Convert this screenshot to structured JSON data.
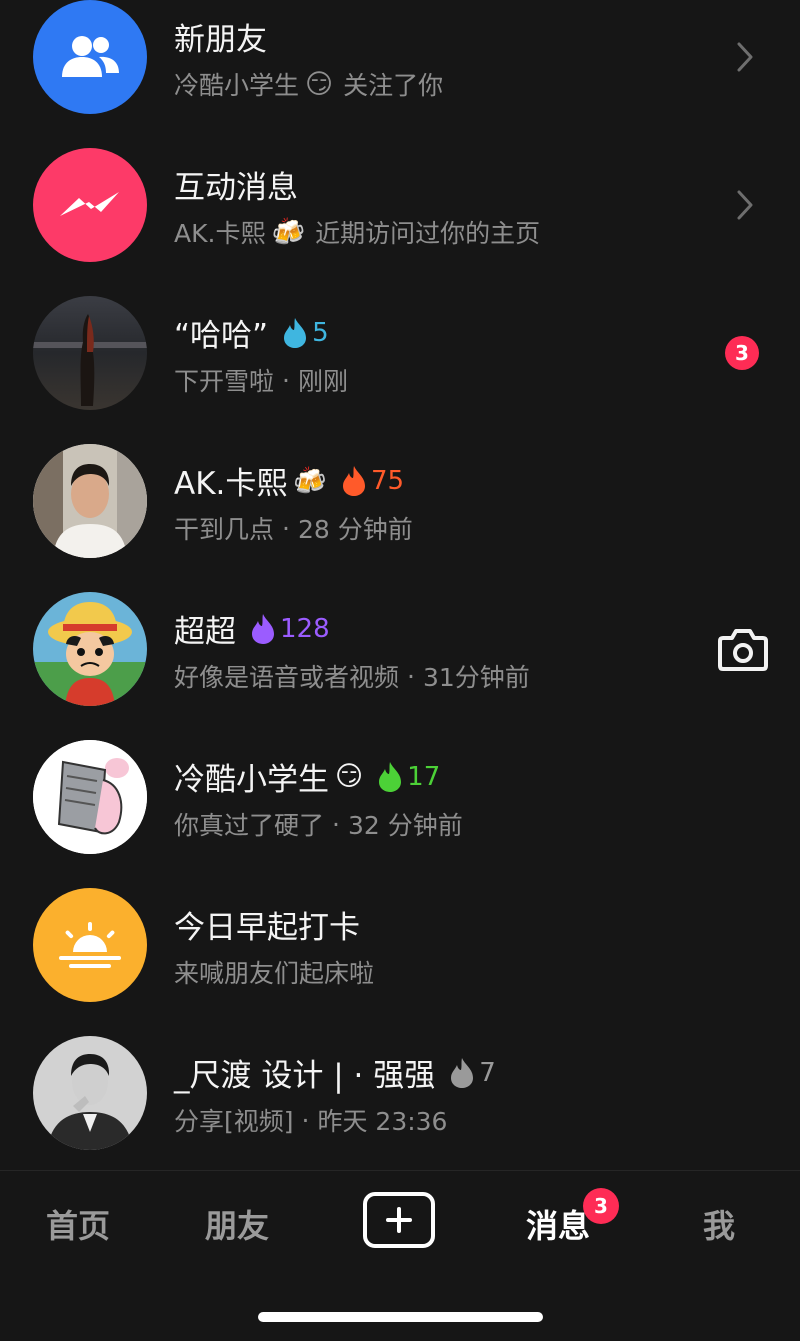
{
  "conversations": [
    {
      "name": "新朋友",
      "subtitle_name": "冷酷小学生",
      "subtitle_emoji": "😏",
      "subtitle_text": "关注了你",
      "avatar_icon": "people-icon",
      "avatar_color": "#2f79f3"
    },
    {
      "name": "互动消息",
      "subtitle_name": "AK.卡熙",
      "subtitle_emoji": "🍻",
      "subtitle_text": "近期访问过你的主页",
      "avatar_icon": "messenger-bolt-icon",
      "avatar_color": "#fd3a68"
    },
    {
      "name": "“哈哈”",
      "streak": "5",
      "streak_color": "#3fb6e0",
      "message": "下开雪啦",
      "dot": "·",
      "time": "刚刚",
      "unread": "3"
    },
    {
      "name": "AK.卡熙",
      "name_emoji": "🍻",
      "streak": "75",
      "streak_color": "#ff5a2a",
      "message": "干到几点",
      "dot": "·",
      "time": "28 分钟前"
    },
    {
      "name": "超超",
      "streak": "128",
      "streak_color": "#9b5cff",
      "message": "好像是语音或者视频",
      "dot": "·",
      "time": "31分钟前"
    },
    {
      "name": "冷酷小学生",
      "name_emoji": "😏",
      "streak": "17",
      "streak_color": "#4cd137",
      "message": "你真过了硬了",
      "dot": "·",
      "time": "32 分钟前"
    },
    {
      "name": "今日早起打卡",
      "message": "来喊朋友们起床啦",
      "avatar_icon": "sunrise-icon",
      "avatar_color": "#fbb02d"
    },
    {
      "name": "_尺渡 设计 | · 强强",
      "streak": "7",
      "streak_color": "#9a9a9a",
      "message": "分享[视频]",
      "dot": "·",
      "time": "昨天 23:36"
    }
  ],
  "tabs": {
    "home": "首页",
    "friends": "朋友",
    "messages": "消息",
    "me": "我",
    "messages_badge": "3"
  }
}
